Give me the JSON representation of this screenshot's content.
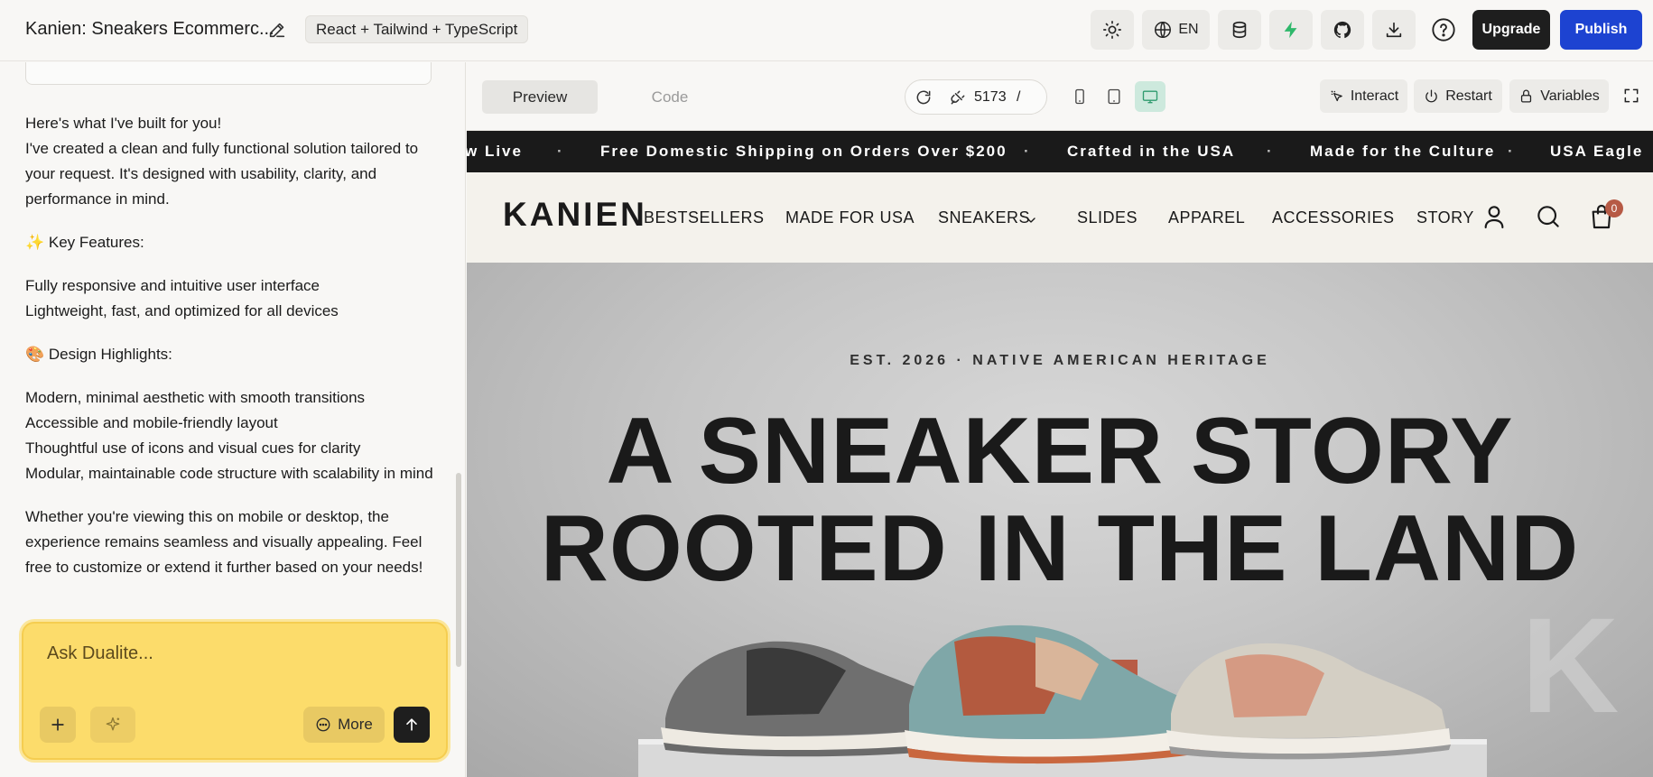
{
  "topbar": {
    "project_title": "Kanien: Sneakers Ecommerc...",
    "stack_badge": "React + Tailwind + TypeScript",
    "lang": "EN",
    "upgrade": "Upgrade",
    "publish": "Publish"
  },
  "chat": {
    "intro_heading": "Here's what I've built for you!",
    "intro_body": "I've created a clean and fully functional solution tailored to your request. It's designed with usability, clarity, and performance in mind.",
    "key_features_title": "✨ Key Features:",
    "key_features": [
      "Fully responsive and intuitive user interface",
      "Lightweight, fast, and optimized for all devices"
    ],
    "design_title": "🎨 Design Highlights:",
    "design_items": [
      "Modern, minimal aesthetic with smooth transitions",
      "Accessible and mobile-friendly layout",
      "Thoughtful use of icons and visual cues for clarity",
      "Modular, maintainable code structure with scalability in mind"
    ],
    "closing": "Whether you're viewing this on mobile or desktop, the experience remains seamless and visually appealing. Feel free to customize or extend it further based on your needs!",
    "input_placeholder": "Ask Dualite...",
    "more_label": "More"
  },
  "preview_toolbar": {
    "tab_preview": "Preview",
    "tab_code": "Code",
    "port": "5173",
    "path": "/",
    "interact": "Interact",
    "restart": "Restart",
    "variables": "Variables"
  },
  "site": {
    "ticker": [
      "w Live",
      "Free Domestic Shipping on Orders Over $200",
      "Crafted in the USA",
      "Made for the Culture",
      "USA Eagle"
    ],
    "logo": "KANIEN",
    "nav": [
      "BESTSELLERS",
      "MADE FOR USA",
      "SNEAKERS",
      "SLIDES",
      "APPAREL",
      "ACCESSORIES",
      "STORY"
    ],
    "cart_count": "0",
    "hero_eyebrow": "EST. 2026 · NATIVE AMERICAN HERITAGE",
    "hero_title_line1": "A SNEAKER STORY",
    "hero_title_line2": "ROOTED IN THE LAND",
    "hero_watermark": "K"
  },
  "colors": {
    "accent_yellow": "#fcdc6b",
    "publish_blue": "#1d43d1",
    "upgrade_black": "#1e1e1e",
    "bolt_green": "#2fb86b",
    "device_active": "#cde9dd",
    "ticker_bg": "#1a1a1a",
    "cart_badge": "#b65a45"
  }
}
